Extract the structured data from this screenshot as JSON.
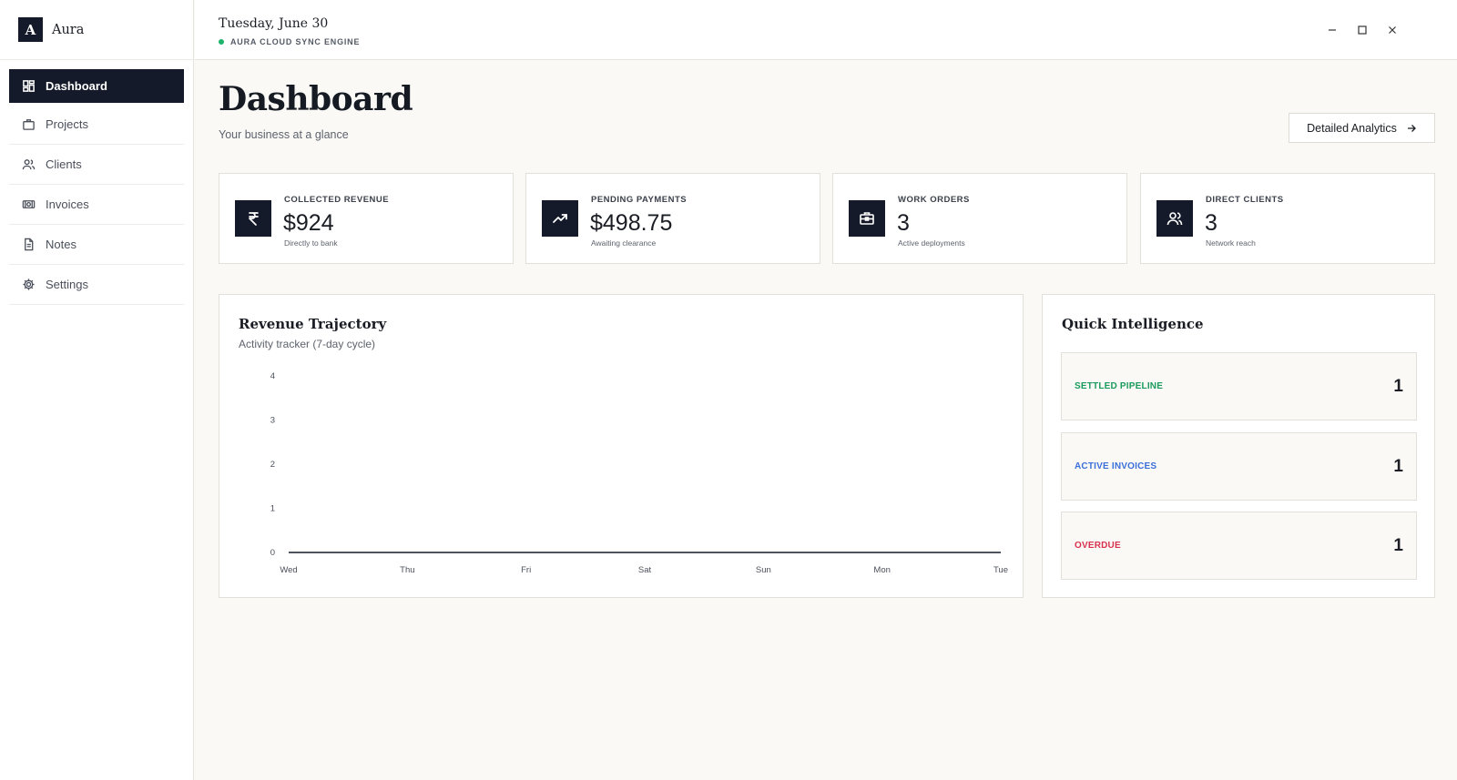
{
  "brand": {
    "logo_letter": "A",
    "name": "Aura"
  },
  "nav": [
    {
      "id": "dashboard",
      "label": "Dashboard",
      "icon": "dashboard-icon",
      "active": true
    },
    {
      "id": "projects",
      "label": "Projects",
      "icon": "briefcase-icon",
      "active": false
    },
    {
      "id": "clients",
      "label": "Clients",
      "icon": "users-icon",
      "active": false
    },
    {
      "id": "invoices",
      "label": "Invoices",
      "icon": "banknote-icon",
      "active": false
    },
    {
      "id": "notes",
      "label": "Notes",
      "icon": "document-icon",
      "active": false
    },
    {
      "id": "settings",
      "label": "Settings",
      "icon": "gear-icon",
      "active": false
    }
  ],
  "topbar": {
    "date": "Tuesday, June 30",
    "sync_status": "AURA CLOUD SYNC ENGINE",
    "sync_color": "#1db36b"
  },
  "page": {
    "title": "Dashboard",
    "subtitle": "Your business at a glance",
    "analytics_button": "Detailed Analytics"
  },
  "stats": [
    {
      "label": "COLLECTED REVENUE",
      "value": "$924",
      "note": "Directly to bank",
      "icon": "rupee-icon"
    },
    {
      "label": "PENDING PAYMENTS",
      "value": "$498.75",
      "note": "Awaiting clearance",
      "icon": "trending-up-icon"
    },
    {
      "label": "WORK ORDERS",
      "value": "3",
      "note": "Active deployments",
      "icon": "toolbox-icon"
    },
    {
      "label": "DIRECT CLIENTS",
      "value": "3",
      "note": "Network reach",
      "icon": "users-icon"
    }
  ],
  "revenue_card": {
    "title": "Revenue Trajectory",
    "subtitle": "Activity tracker (7-day cycle)"
  },
  "chart_data": {
    "type": "line",
    "categories": [
      "Wed",
      "Thu",
      "Fri",
      "Sat",
      "Sun",
      "Mon",
      "Tue"
    ],
    "values": [
      0,
      0,
      0,
      0,
      0,
      0,
      0
    ],
    "ylim": [
      0,
      4
    ],
    "yticks": [
      0,
      1,
      2,
      3,
      4
    ],
    "grid": false,
    "line_color": "#141a29"
  },
  "intel_card": {
    "title": "Quick Intelligence",
    "items": [
      {
        "label": "SETTLED PIPELINE",
        "count": "1",
        "color": "#1a9a5c"
      },
      {
        "label": "ACTIVE INVOICES",
        "count": "1",
        "color": "#3b6fd8"
      },
      {
        "label": "OVERDUE",
        "count": "1",
        "color": "#d8324f"
      }
    ]
  },
  "colors": {
    "primary": "#141a29",
    "background": "#faf9f6"
  }
}
